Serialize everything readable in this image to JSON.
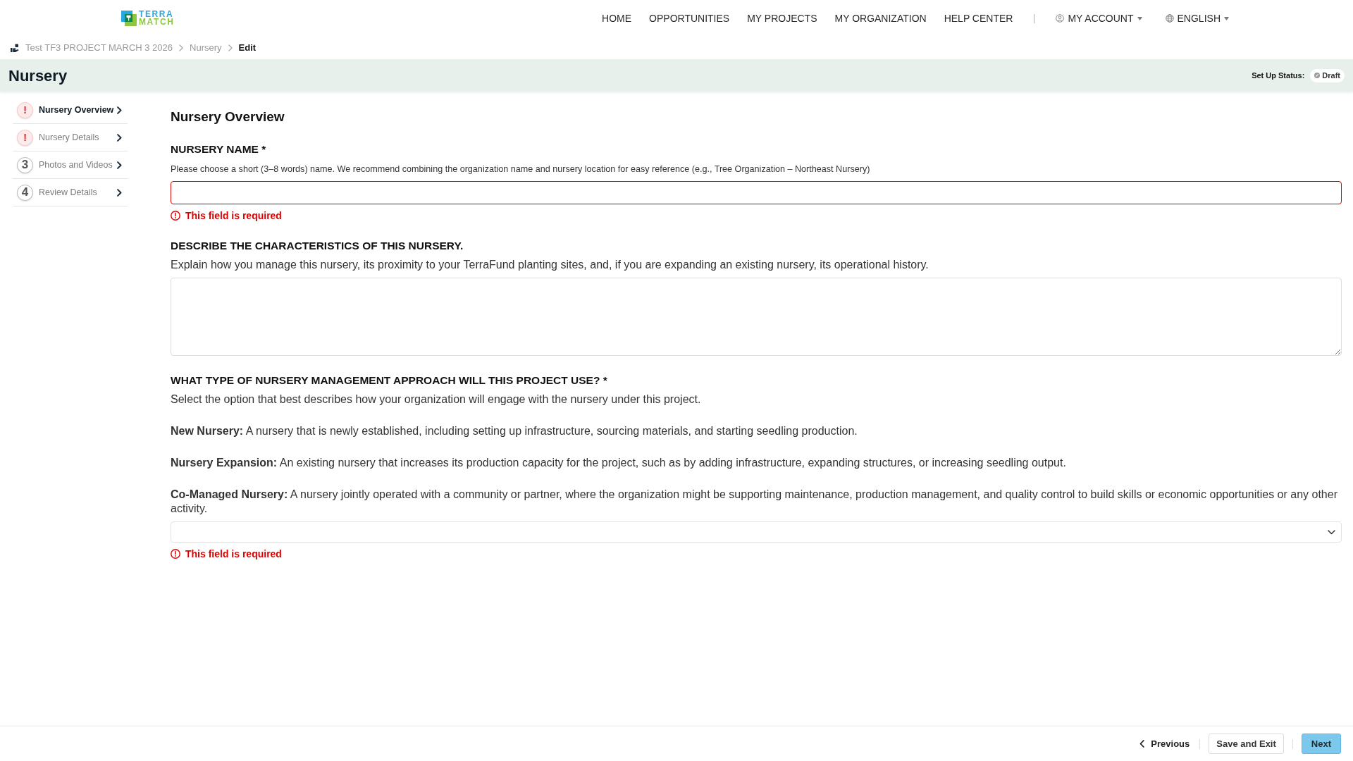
{
  "header": {
    "logo": {
      "line_1": "TERRA",
      "line_2": "MATCH"
    },
    "nav": [
      "HOME",
      "OPPORTUNITIES",
      "MY PROJECTS",
      "MY ORGANIZATION",
      "HELP CENTER"
    ],
    "account_menu": {
      "label": "MY ACCOUNT"
    },
    "language_menu": {
      "label": "ENGLISH"
    }
  },
  "breadcrumb": [
    {
      "label": "Test TF3 PROJECT MARCH 3 2026",
      "current": false
    },
    {
      "label": "Nursery",
      "current": false
    },
    {
      "label": "Edit",
      "current": true
    }
  ],
  "page_header": {
    "title": "Nursery",
    "status_label": "Set Up Status:",
    "status": "Draft"
  },
  "steps": [
    {
      "kind": "error",
      "marker": "!",
      "label": "Nursery Overview",
      "selected": true
    },
    {
      "kind": "error",
      "marker": "!",
      "label": "Nursery Details",
      "selected": false
    },
    {
      "kind": "number",
      "marker": "3",
      "label": "Photos and Videos",
      "selected": false
    },
    {
      "kind": "number",
      "marker": "4",
      "label": "Review Details",
      "selected": false
    }
  ],
  "form": {
    "title": "Nursery Overview",
    "fields": [
      {
        "kind": "text",
        "label": "NURSERY NAME *",
        "help": [
          "Please choose a short (3–8 words) name. We recommend combining the organization name and nursery location for easy reference (e.g., Tree Organization – Northeast Nursery)"
        ],
        "error": "This field is required"
      },
      {
        "kind": "textarea",
        "label": "DESCRIBE THE CHARACTERISTICS OF THIS NURSERY.",
        "help": [
          "Explain how you manage this nursery, its proximity to your TerraFund planting sites, and, if you are expanding an existing nursery, its operational history."
        ]
      },
      {
        "kind": "select",
        "label": "WHAT TYPE OF NURSERY MANAGEMENT APPROACH WILL THIS PROJECT USE? *",
        "help": [
          "Select the option that best describes how your organization will engage with the nursery under this project.",
          "**New Nursery:** A nursery that is newly established, including setting up infrastructure, sourcing materials, and starting seedling production.",
          "**Nursery Expansion:** An existing nursery that increases its production capacity for the project, such as by adding infrastructure, expanding structures, or increasing seedling output.",
          "**Co-Managed Nursery:** A nursery jointly operated with a community or partner, where the organization might be supporting maintenance, production management, and quality control to build skills or economic opportunities or any other activity."
        ],
        "error": "This field is required"
      }
    ]
  },
  "footer": {
    "buttons": [
      {
        "kind": "back",
        "label": "Previous"
      },
      {
        "kind": "outline",
        "label": "Save and Exit"
      },
      {
        "kind": "primary",
        "label": "Next"
      }
    ]
  }
}
